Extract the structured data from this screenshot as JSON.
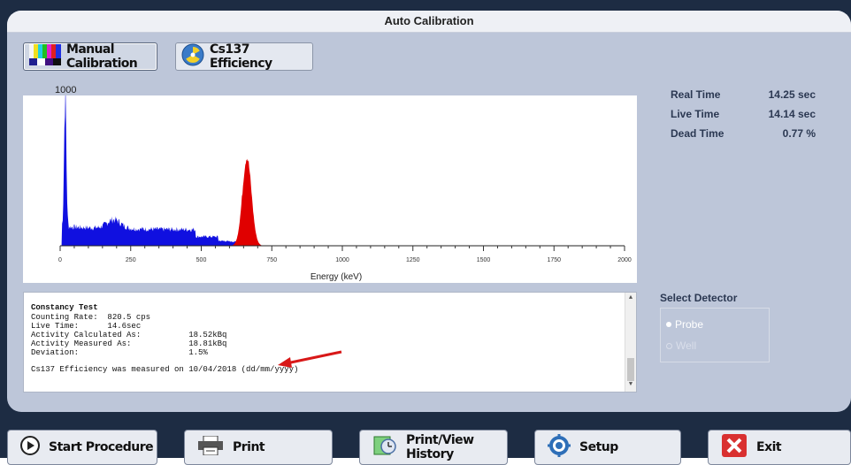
{
  "window": {
    "title": "Auto Calibration"
  },
  "tabs": [
    {
      "label": "Manual Calibration",
      "icon": "color-bars-icon"
    },
    {
      "label": "Cs137 Efficiency",
      "icon": "radiation-icon"
    }
  ],
  "spectrum": {
    "y_max_label": "1000",
    "x_axis_label": "Energy (keV)",
    "x_ticks": [
      "0",
      "250",
      "500",
      "750",
      "1000",
      "1250",
      "1500",
      "1750",
      "2000"
    ],
    "colors": {
      "spectrum": "#1010e0",
      "peak": "#e00000"
    }
  },
  "stats": [
    {
      "label": "Real Time",
      "value": "14.25 sec"
    },
    {
      "label": "Live Time",
      "value": "14.14 sec"
    },
    {
      "label": "Dead Time",
      "value": "0.77 %"
    }
  ],
  "report": {
    "title": "Constancy Test",
    "rows": [
      "Counting Rate:  820.5 cps",
      "Live Time:      14.6sec",
      "Activity Calculated As:          18.52kBq",
      "Activity Measured As:            18.81kBq",
      "Deviation:                       1.5%"
    ],
    "footer": "Cs137 Efficiency was measured on 10/04/2018 (dd/mm/yyyy)"
  },
  "detector": {
    "title": "Select Detector",
    "options": [
      {
        "label": "Probe",
        "selected": true
      },
      {
        "label": "Well",
        "selected": false
      }
    ]
  },
  "buttons": [
    {
      "label": "Start Procedure",
      "icon": "play-icon"
    },
    {
      "label": "Print",
      "icon": "printer-icon"
    },
    {
      "label": "Print/View History",
      "icon": "history-icon"
    },
    {
      "label": "Setup",
      "icon": "gear-icon"
    },
    {
      "label": "Exit",
      "icon": "close-icon"
    }
  ]
}
